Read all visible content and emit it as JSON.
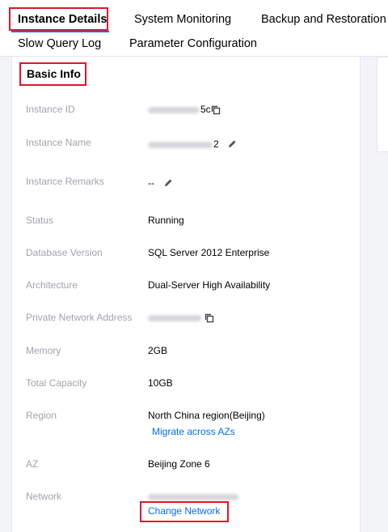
{
  "tabs": [
    {
      "label": "Instance Details"
    },
    {
      "label": "System Monitoring"
    },
    {
      "label": "Backup and Restoration"
    },
    {
      "label": "Slow Query Log"
    },
    {
      "label": "Parameter Configuration"
    }
  ],
  "section": {
    "title": "Basic Info"
  },
  "fields": {
    "instance_id": {
      "label": "Instance ID",
      "value_suffix": "5c"
    },
    "instance_name": {
      "label": "Instance Name",
      "value_suffix": "2"
    },
    "instance_remarks": {
      "label": "Instance Remarks",
      "value": "--"
    },
    "status": {
      "label": "Status",
      "value": "Running"
    },
    "db_version": {
      "label": "Database Version",
      "value": "SQL Server 2012 Enterprise"
    },
    "architecture": {
      "label": "Architecture",
      "value": "Dual-Server High Availability"
    },
    "private_address": {
      "label": "Private Network Address"
    },
    "memory": {
      "label": "Memory",
      "value": "2GB"
    },
    "total_capacity": {
      "label": "Total Capacity",
      "value": "10GB"
    },
    "region": {
      "label": "Region",
      "value": "North China region(Beijing)",
      "link": "Migrate across AZs"
    },
    "az": {
      "label": "AZ",
      "value": "Beijing Zone 6"
    },
    "network": {
      "label": "Network",
      "link": "Change Network"
    }
  },
  "icons": {
    "copy": "copy-icon",
    "edit": "edit-icon"
  },
  "colors": {
    "highlight": "#e0162b",
    "link": "#006eff",
    "label": "#a0a4ab"
  }
}
